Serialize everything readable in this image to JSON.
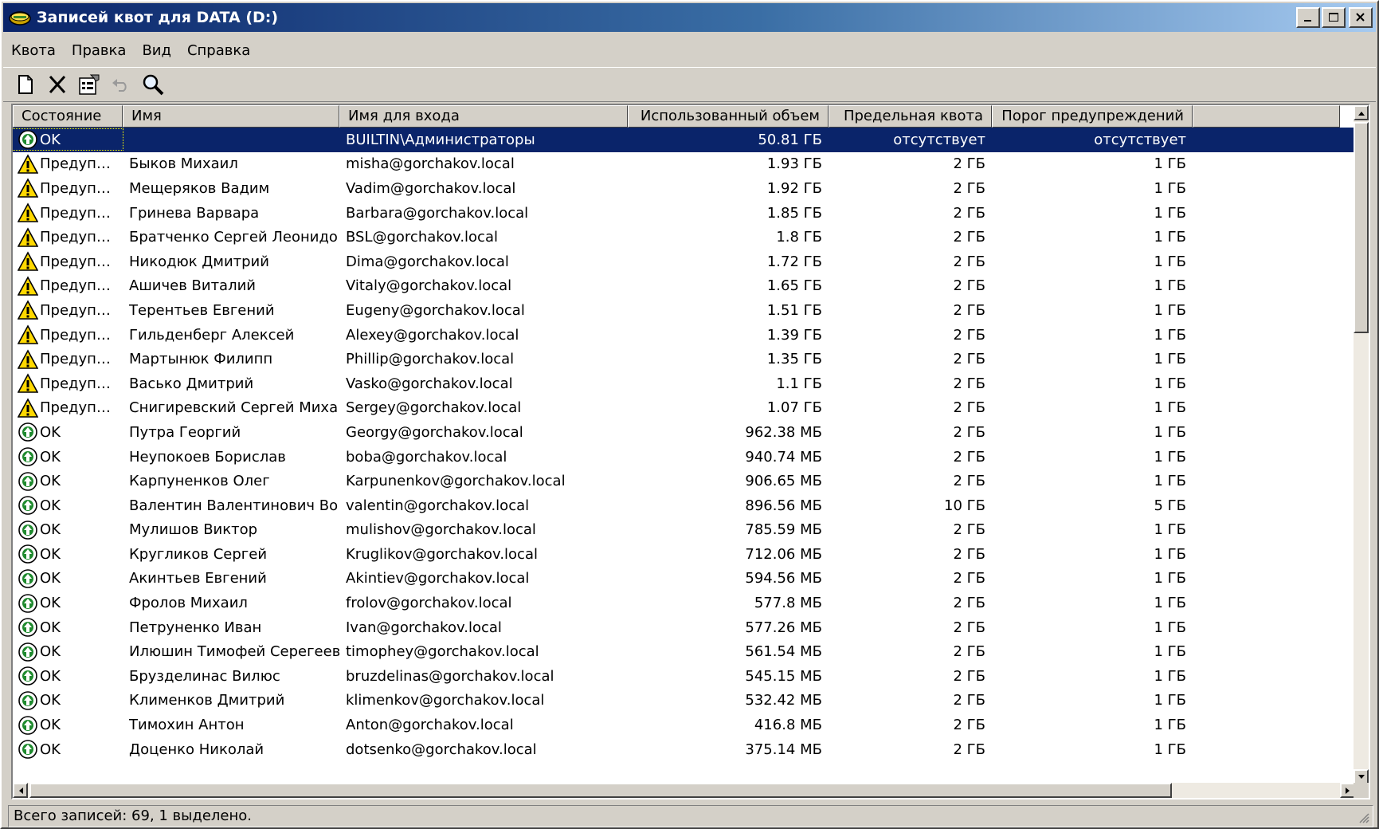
{
  "window": {
    "title": "Записей квот для DATA (D:)",
    "buttons": [
      "minimize-icon",
      "maximize-icon",
      "close-icon"
    ]
  },
  "menu": [
    {
      "label": "Квота"
    },
    {
      "label": "Правка"
    },
    {
      "label": "Вид"
    },
    {
      "label": "Справка"
    }
  ],
  "toolbar": [
    {
      "name": "new-quota-button",
      "icon": "new-document-icon"
    },
    {
      "name": "delete-button",
      "icon": "delete-x-icon"
    },
    {
      "name": "properties-button",
      "icon": "properties-icon"
    },
    {
      "name": "undo-button",
      "icon": "undo-icon"
    },
    {
      "name": "find-button",
      "icon": "magnifier-icon"
    }
  ],
  "table": {
    "columns": [
      {
        "label": "Состояние"
      },
      {
        "label": "Имя"
      },
      {
        "label": "Имя для входа"
      },
      {
        "label": "Использованный объем"
      },
      {
        "label": "Предельная квота"
      },
      {
        "label": "Порог предупреждений"
      }
    ],
    "rows": [
      {
        "status": "OK",
        "icon": "ok-icon",
        "name": "",
        "login": "BUILTIN\\Администраторы",
        "used": "50.81 ГБ",
        "limit": "отсутствует",
        "warn": "отсутствует",
        "selected": true
      },
      {
        "status": "Предуп…",
        "icon": "warning-icon",
        "name": "Быков Михаил",
        "login": "misha@gorchakov.local",
        "used": "1.93 ГБ",
        "limit": "2 ГБ",
        "warn": "1 ГБ"
      },
      {
        "status": "Предуп…",
        "icon": "warning-icon",
        "name": "Мещеряков Вадим",
        "login": "Vadim@gorchakov.local",
        "used": "1.92 ГБ",
        "limit": "2 ГБ",
        "warn": "1 ГБ"
      },
      {
        "status": "Предуп…",
        "icon": "warning-icon",
        "name": "Гринева Варвара",
        "login": "Barbara@gorchakov.local",
        "used": "1.85 ГБ",
        "limit": "2 ГБ",
        "warn": "1 ГБ"
      },
      {
        "status": "Предуп…",
        "icon": "warning-icon",
        "name": "Братченко Сергей Леонидо…",
        "login": "BSL@gorchakov.local",
        "used": "1.8 ГБ",
        "limit": "2 ГБ",
        "warn": "1 ГБ"
      },
      {
        "status": "Предуп…",
        "icon": "warning-icon",
        "name": "Никодюк Дмитрий",
        "login": "Dima@gorchakov.local",
        "used": "1.72 ГБ",
        "limit": "2 ГБ",
        "warn": "1 ГБ"
      },
      {
        "status": "Предуп…",
        "icon": "warning-icon",
        "name": "Ашичев Виталий",
        "login": "Vitaly@gorchakov.local",
        "used": "1.65 ГБ",
        "limit": "2 ГБ",
        "warn": "1 ГБ"
      },
      {
        "status": "Предуп…",
        "icon": "warning-icon",
        "name": "Терентьев Евгений",
        "login": "Eugeny@gorchakov.local",
        "used": "1.51 ГБ",
        "limit": "2 ГБ",
        "warn": "1 ГБ"
      },
      {
        "status": "Предуп…",
        "icon": "warning-icon",
        "name": "Гильденберг Алексей",
        "login": "Alexey@gorchakov.local",
        "used": "1.39 ГБ",
        "limit": "2 ГБ",
        "warn": "1 ГБ"
      },
      {
        "status": "Предуп…",
        "icon": "warning-icon",
        "name": "Мартынюк Филипп",
        "login": "Phillip@gorchakov.local",
        "used": "1.35 ГБ",
        "limit": "2 ГБ",
        "warn": "1 ГБ"
      },
      {
        "status": "Предуп…",
        "icon": "warning-icon",
        "name": "Васько Дмитрий",
        "login": "Vasko@gorchakov.local",
        "used": "1.1 ГБ",
        "limit": "2 ГБ",
        "warn": "1 ГБ"
      },
      {
        "status": "Предуп…",
        "icon": "warning-icon",
        "name": "Снигиревский Сергей Миха…",
        "login": "Sergey@gorchakov.local",
        "used": "1.07 ГБ",
        "limit": "2 ГБ",
        "warn": "1 ГБ"
      },
      {
        "status": "OK",
        "icon": "ok-icon",
        "name": "Путра Георгий",
        "login": "Georgy@gorchakov.local",
        "used": "962.38 МБ",
        "limit": "2 ГБ",
        "warn": "1 ГБ"
      },
      {
        "status": "OK",
        "icon": "ok-icon",
        "name": "Неупокоев Борислав",
        "login": "boba@gorchakov.local",
        "used": "940.74 МБ",
        "limit": "2 ГБ",
        "warn": "1 ГБ"
      },
      {
        "status": "OK",
        "icon": "ok-icon",
        "name": "Карпуненков Олег",
        "login": "Karpunenkov@gorchakov.local",
        "used": "906.65 МБ",
        "limit": "2 ГБ",
        "warn": "1 ГБ"
      },
      {
        "status": "OK",
        "icon": "ok-icon",
        "name": "Валентин Валентинович Во…",
        "login": "valentin@gorchakov.local",
        "used": "896.56 МБ",
        "limit": "10 ГБ",
        "warn": "5 ГБ"
      },
      {
        "status": "OK",
        "icon": "ok-icon",
        "name": "Мулишов Виктор",
        "login": "mulishov@gorchakov.local",
        "used": "785.59 МБ",
        "limit": "2 ГБ",
        "warn": "1 ГБ"
      },
      {
        "status": "OK",
        "icon": "ok-icon",
        "name": "Кругликов Сергей",
        "login": "Kruglikov@gorchakov.local",
        "used": "712.06 МБ",
        "limit": "2 ГБ",
        "warn": "1 ГБ"
      },
      {
        "status": "OK",
        "icon": "ok-icon",
        "name": "Акинтьев Евгений",
        "login": "Akintiev@gorchakov.local",
        "used": "594.56 МБ",
        "limit": "2 ГБ",
        "warn": "1 ГБ"
      },
      {
        "status": "OK",
        "icon": "ok-icon",
        "name": "Фролов Михаил",
        "login": "frolov@gorchakov.local",
        "used": "577.8 МБ",
        "limit": "2 ГБ",
        "warn": "1 ГБ"
      },
      {
        "status": "OK",
        "icon": "ok-icon",
        "name": "Петруненко Иван",
        "login": "Ivan@gorchakov.local",
        "used": "577.26 МБ",
        "limit": "2 ГБ",
        "warn": "1 ГБ"
      },
      {
        "status": "OK",
        "icon": "ok-icon",
        "name": "Илюшин Тимофей Серегеевич",
        "login": "timophey@gorchakov.local",
        "used": "561.54 МБ",
        "limit": "2 ГБ",
        "warn": "1 ГБ"
      },
      {
        "status": "OK",
        "icon": "ok-icon",
        "name": "Брузделинас Вилюс",
        "login": "bruzdelinas@gorchakov.local",
        "used": "545.15 МБ",
        "limit": "2 ГБ",
        "warn": "1 ГБ"
      },
      {
        "status": "OK",
        "icon": "ok-icon",
        "name": "Клименков Дмитрий",
        "login": "klimenkov@gorchakov.local",
        "used": "532.42 МБ",
        "limit": "2 ГБ",
        "warn": "1 ГБ"
      },
      {
        "status": "OK",
        "icon": "ok-icon",
        "name": "Тимохин Антон",
        "login": "Anton@gorchakov.local",
        "used": "416.8 МБ",
        "limit": "2 ГБ",
        "warn": "1 ГБ"
      },
      {
        "status": "OK",
        "icon": "ok-icon",
        "name": "Доценко Николай",
        "login": "dotsenko@gorchakov.local",
        "used": "375.14 МБ",
        "limit": "2 ГБ",
        "warn": "1 ГБ"
      }
    ]
  },
  "statusbar": {
    "text": "Всего записей: 69, 1 выделено."
  },
  "colors": {
    "selection": "#0a246a",
    "titlebar_start": "#0a246a",
    "titlebar_end": "#a6caf0",
    "window_face": "#d4d0c8",
    "warning_yellow": "#ffd800",
    "ok_green": "#1f8a2e"
  }
}
